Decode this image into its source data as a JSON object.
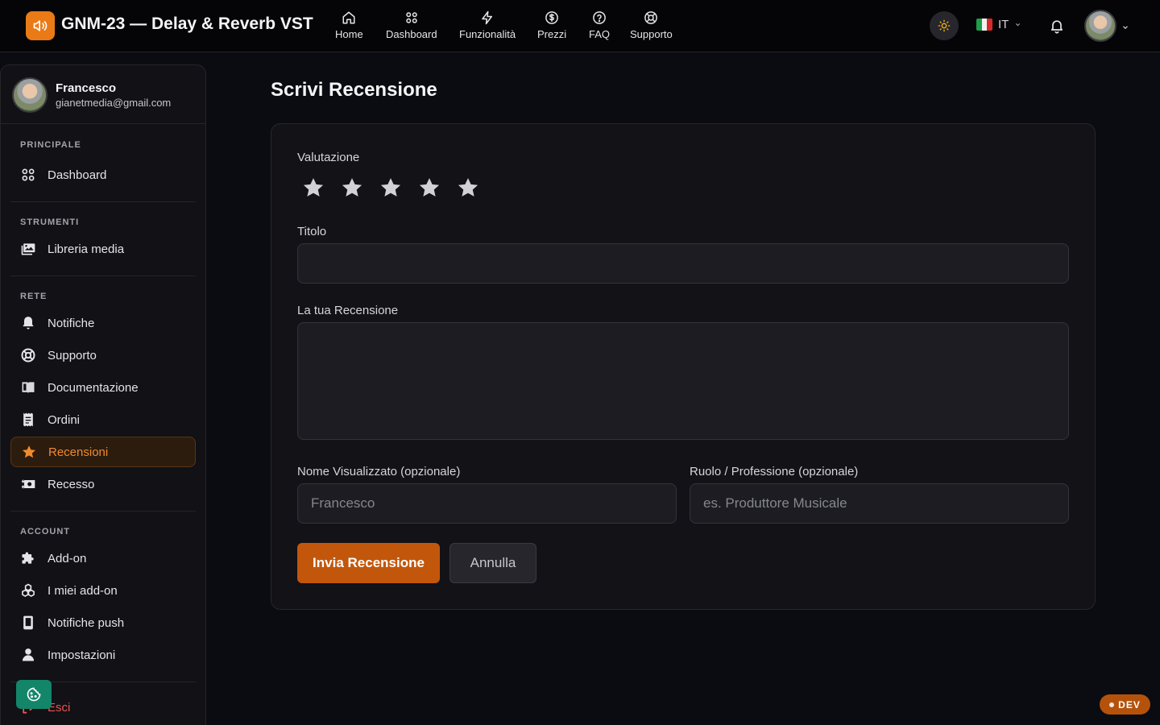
{
  "header": {
    "app_title": "GNM-23 — Delay & Reverb VST",
    "nav": [
      {
        "label": "Home",
        "icon": "home-icon"
      },
      {
        "label": "Dashboard",
        "icon": "grid-icon"
      },
      {
        "label": "Funzionalità",
        "icon": "lightning-icon"
      },
      {
        "label": "Prezzi",
        "icon": "dollar-icon"
      },
      {
        "label": "FAQ",
        "icon": "question-icon"
      },
      {
        "label": "Supporto",
        "icon": "lifebuoy-icon"
      }
    ],
    "language": "IT",
    "accent_color": "#ea7a16"
  },
  "sidebar": {
    "user_name": "Francesco",
    "user_email": "gianetmedia@gmail.com",
    "sections": {
      "principale": "PRINCIPALE",
      "strumenti": "STRUMENTI",
      "rete": "RETE",
      "account": "ACCOUNT"
    },
    "items": {
      "dashboard": "Dashboard",
      "media": "Libreria media",
      "notifiche": "Notifiche",
      "supporto": "Supporto",
      "documentazione": "Documentazione",
      "ordini": "Ordini",
      "recensioni": "Recensioni",
      "recesso": "Recesso",
      "addon": "Add-on",
      "miei_addon": "I miei add-on",
      "push": "Notifiche push",
      "impostazioni": "Impostazioni",
      "esci": "Esci"
    },
    "active_item": "Recensioni"
  },
  "main": {
    "title": "Scrivi Recensione",
    "rating_label": "Valutazione",
    "rating_value": 0,
    "rating_max": 5,
    "title_label": "Titolo",
    "title_value": "",
    "review_label": "La tua Recensione",
    "review_value": "",
    "display_name_label": "Nome Visualizzato (opzionale)",
    "display_name_placeholder": "Francesco",
    "role_label": "Ruolo / Professione (opzionale)",
    "role_placeholder": "es. Produttore Musicale",
    "submit_label": "Invia Recensione",
    "cancel_label": "Annulla"
  },
  "dev_badge": "DEV"
}
